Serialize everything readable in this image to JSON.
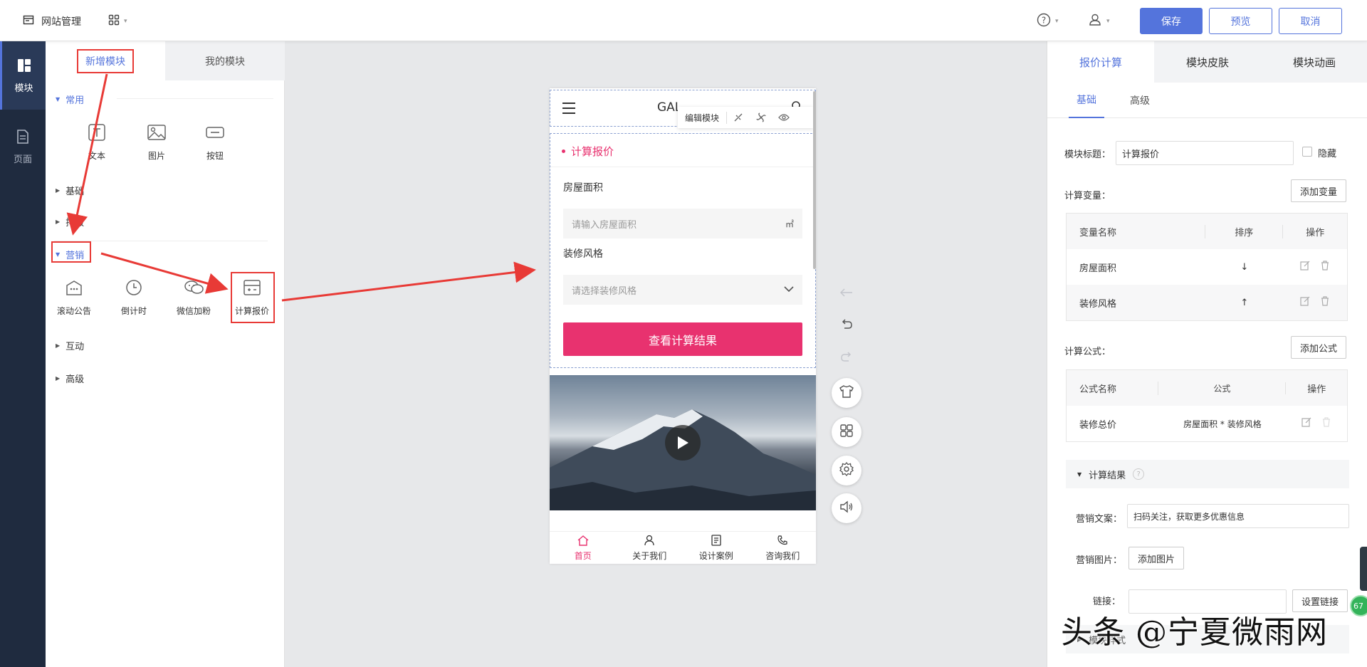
{
  "topbar": {
    "site_label": "网站管理",
    "save_label": "保存",
    "preview_label": "预览",
    "cancel_label": "取消"
  },
  "rail": {
    "items": [
      {
        "label": "模块",
        "icon": "module-icon",
        "active": true
      },
      {
        "label": "页面",
        "icon": "page-icon",
        "active": false
      }
    ]
  },
  "left_panel": {
    "tabs": [
      "新增模块",
      "我的模块"
    ],
    "sections": {
      "common": "常用",
      "basic": "基础",
      "layout": "排版",
      "marketing": "营销",
      "interactive": "互动",
      "advanced": "高级"
    },
    "common_tools": [
      "文本",
      "图片",
      "按钮"
    ],
    "marketing_tools": [
      "滚动公告",
      "倒计时",
      "微信加粉",
      "计算报价"
    ]
  },
  "phone": {
    "brand": "GAL",
    "edit_toolbar_label": "编辑模块",
    "calc_title": "计算报价",
    "field1_label": "房屋面积",
    "field1_placeholder": "请输入房屋面积",
    "field1_unit": "㎡",
    "field2_label": "装修风格",
    "field2_placeholder": "请选择装修风格",
    "calc_button": "查看计算结果",
    "tabbar": [
      "首页",
      "关于我们",
      "设计案例",
      "咨询我们"
    ]
  },
  "right_panel": {
    "tabs": [
      "报价计算",
      "模块皮肤",
      "模块动画"
    ],
    "subtabs": [
      "基础",
      "高级"
    ],
    "module_title_label": "模块标题：",
    "module_title_value": "计算报价",
    "hide_label": "隐藏",
    "variables_label": "计算变量：",
    "add_variable": "添加变量",
    "var_table": {
      "headers": [
        "变量名称",
        "排序",
        "操作"
      ],
      "rows": [
        {
          "name": "房屋面积",
          "sort": "↓"
        },
        {
          "name": "装修风格",
          "sort": "↑"
        }
      ]
    },
    "formula_label": "计算公式：",
    "add_formula": "添加公式",
    "formula_table": {
      "headers": [
        "公式名称",
        "公式",
        "操作"
      ],
      "rows": [
        {
          "name": "装修总价",
          "formula": "房屋面积 * 装修风格"
        }
      ]
    },
    "result_section": "计算结果",
    "marketing_text_label": "营销文案：",
    "marketing_text_value": "扫码关注，获取更多优惠信息",
    "marketing_image_label": "营销图片：",
    "add_image": "添加图片",
    "link_label": "链接：",
    "set_link": "设置链接",
    "style_section": "模块样式"
  },
  "overlay": {
    "watermark": "头条 @宁夏微雨网",
    "badge": "67"
  },
  "colors": {
    "accent": "#5474dc",
    "pink": "#e8326f",
    "rail_bg": "#1f2b3f",
    "annotation_red": "#e83a36"
  }
}
